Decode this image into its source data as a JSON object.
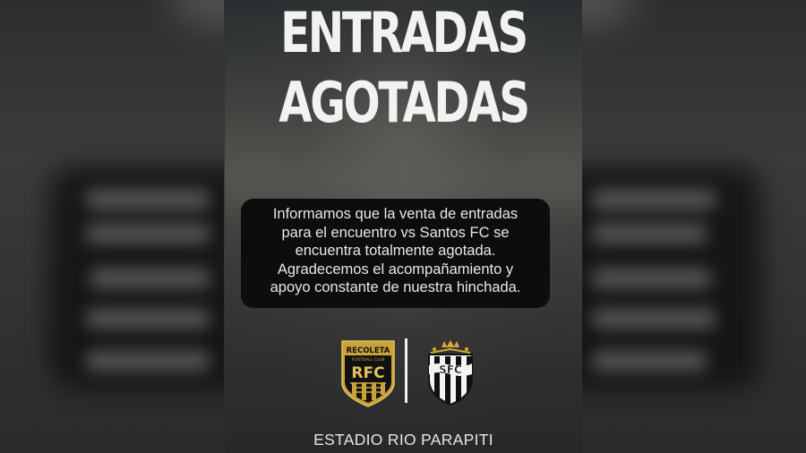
{
  "poster": {
    "title_line1": "ENTRADAS",
    "title_line2": "AGOTADAS",
    "message_lines": [
      "Informamos que la venta de entradas",
      "para el encuentro vs Santos FC se",
      "encuentra totalmente agotada.",
      "Agradecemos el acompañamiento y",
      "apoyo constante de nuestra hinchada."
    ],
    "stadium": "ESTADIO RIO PARAPITI"
  },
  "logos": {
    "home_crest": {
      "icon": "recoleta-fc-crest-icon",
      "lettering": [
        "RECOLETA",
        "FOOTBALL CLUB",
        "RFC"
      ]
    },
    "away_crest": {
      "icon": "santos-fc-crest-icon",
      "lettering": [
        "SFC"
      ]
    }
  },
  "colors": {
    "title": "#f2f2f2",
    "message_box": "#0d0d0d",
    "home_gold": "#c9a23a",
    "home_black": "#111111"
  }
}
